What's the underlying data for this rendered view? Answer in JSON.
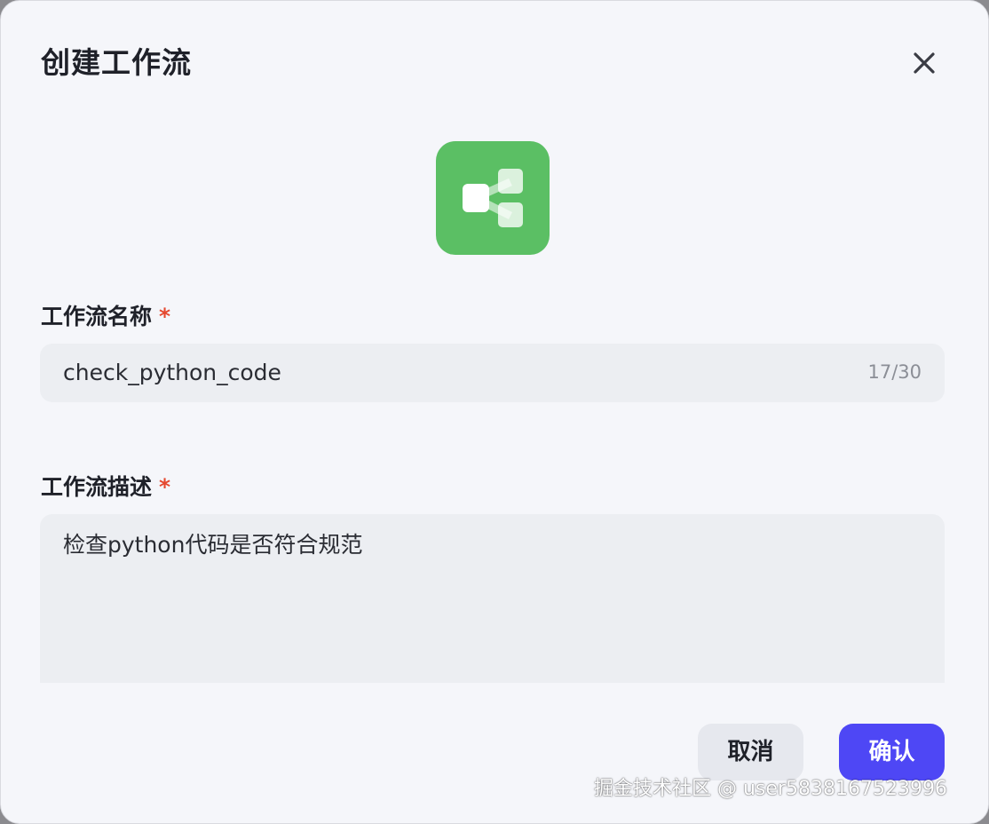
{
  "dialog": {
    "title": "创建工作流",
    "close_icon": "close-icon",
    "workflow_icon": "workflow-tree-icon",
    "icon_bg_color": "#5bbf64"
  },
  "name_field": {
    "label": "工作流名称",
    "required_mark": "*",
    "value": "check_python_code",
    "counter": "17/30"
  },
  "desc_field": {
    "label": "工作流描述",
    "required_mark": "*",
    "value": "检查python代码是否符合规范"
  },
  "footer": {
    "cancel_label": "取消",
    "confirm_label": "确认",
    "confirm_color": "#4e47f5"
  },
  "watermark": "掘金技术社区 @ user5838167523996"
}
